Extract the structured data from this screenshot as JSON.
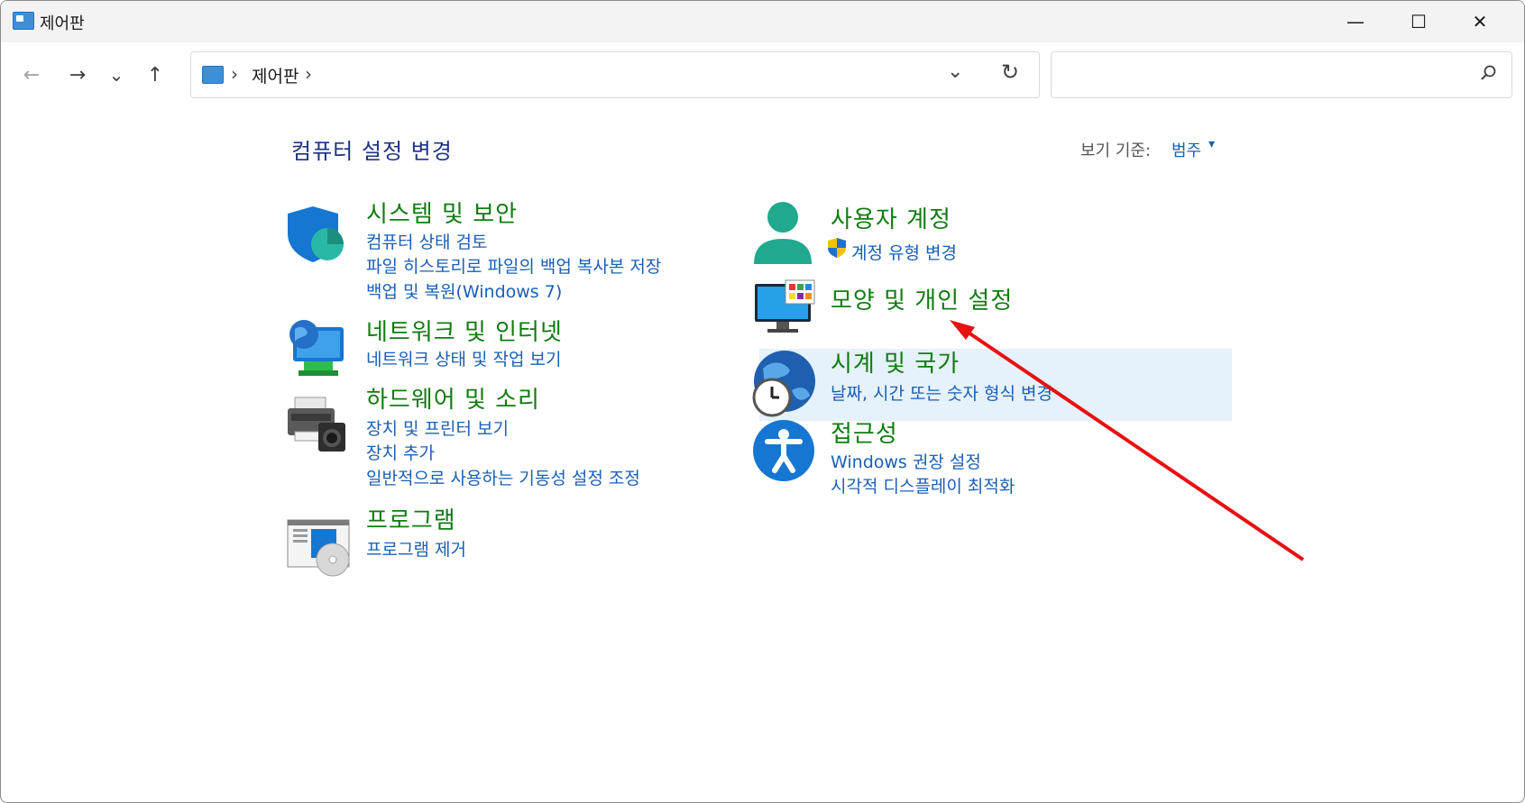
{
  "window": {
    "title": "제어판",
    "minimize_glyph": "—",
    "maximize_glyph": "☐",
    "close_glyph": "✕"
  },
  "nav": {
    "back_glyph": "←",
    "forward_glyph": "→",
    "recent_glyph": "⌄",
    "up_glyph": "↑"
  },
  "address": {
    "separator": "›",
    "location": "제어판",
    "dropdown_glyph": "⌄",
    "refresh_glyph": "↻"
  },
  "search": {
    "placeholder": ""
  },
  "content": {
    "heading": "컴퓨터 설정 변경",
    "viewby_label": "보기 기준:",
    "viewby_value": "범주",
    "viewby_arrow": "▾"
  },
  "categories_left": [
    {
      "title": "시스템 및 보안",
      "icon": "shield-icon",
      "links": [
        "컴퓨터 상태 검토",
        "파일 히스토리로 파일의 백업 복사본 저장",
        "백업 및 복원(Windows 7)"
      ]
    },
    {
      "title": "네트워크 및 인터넷",
      "icon": "network-globe-icon",
      "links": [
        "네트워크 상태 및 작업 보기"
      ]
    },
    {
      "title": "하드웨어 및 소리",
      "icon": "printer-camera-icon",
      "links": [
        "장치 및 프린터 보기",
        "장치 추가",
        "일반적으로 사용하는 기동성 설정 조정"
      ]
    },
    {
      "title": "프로그램",
      "icon": "programs-disc-icon",
      "links": [
        "프로그램 제거"
      ]
    }
  ],
  "categories_right": [
    {
      "title": "사용자 계정",
      "icon": "user-icon",
      "links": [
        "계정 유형 변경"
      ]
    },
    {
      "title": "모양 및 개인 설정",
      "icon": "monitor-icon",
      "links": []
    },
    {
      "title": "시계 및 국가",
      "icon": "globe-clock-icon",
      "links": [
        "날짜, 시간 또는 숫자 형식 변경"
      ]
    },
    {
      "title": "접근성",
      "icon": "accessibility-icon",
      "links": [
        "Windows 권장 설정",
        "시각적 디스플레이 최적화"
      ]
    }
  ],
  "colors": {
    "category_title": "#107c10",
    "link": "#1a5fb4",
    "heading": "#1e3287",
    "hover": "#e5f1fb",
    "annotation_arrow": "#e81010"
  }
}
